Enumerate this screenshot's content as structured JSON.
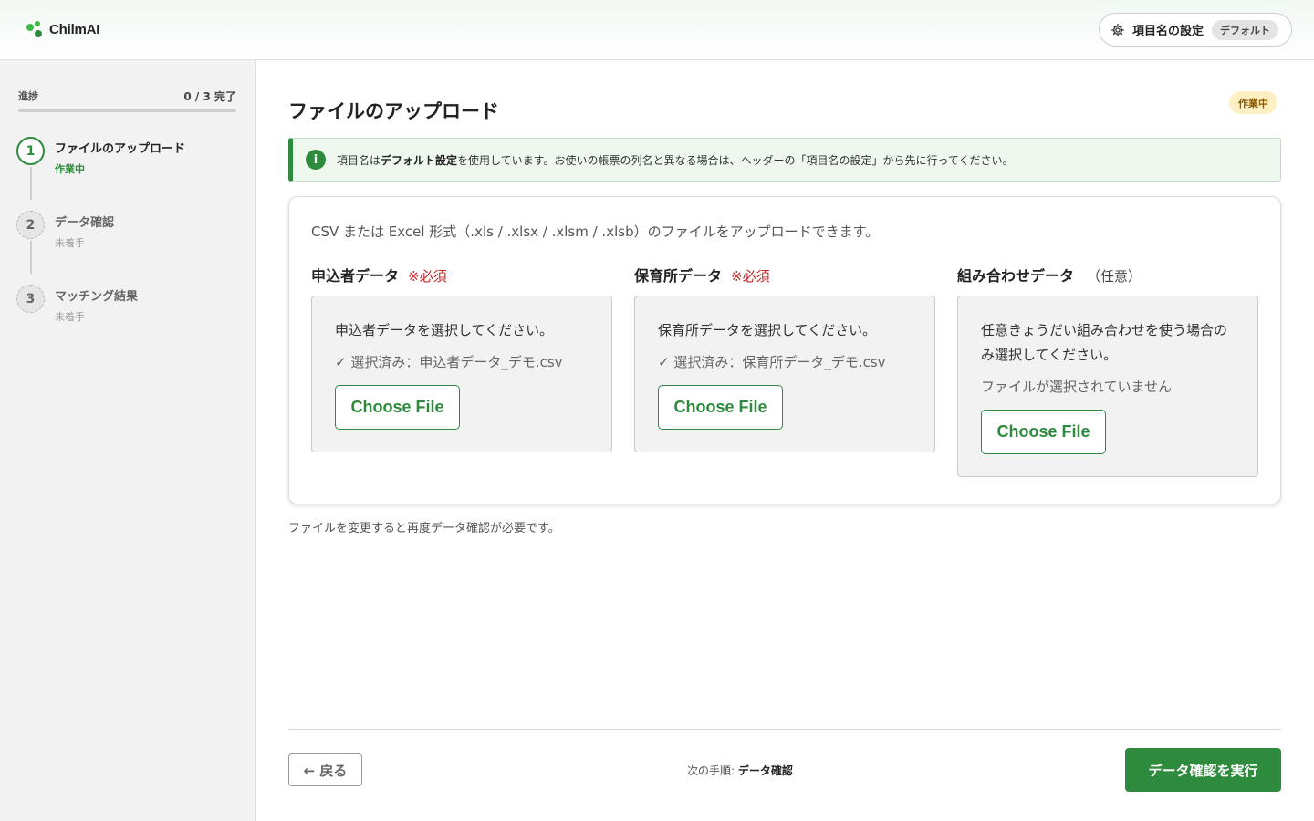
{
  "app": {
    "logo_text": "ChilmAI",
    "brand_color": "#2e8b3d"
  },
  "header": {
    "settings_label": "項目名の設定",
    "settings_badge": "デフォルト",
    "settings_icon": "gear-icon"
  },
  "sidebar": {
    "progress_label": "進捗",
    "progress_count": "0 / 3 完了",
    "progress_fraction": 0,
    "steps": [
      {
        "number": "1",
        "title": "ファイルのアップロード",
        "status": "作業中",
        "state": "active"
      },
      {
        "number": "2",
        "title": "データ確認",
        "status": "未着手",
        "state": "pending"
      },
      {
        "number": "3",
        "title": "マッチング結果",
        "status": "未着手",
        "state": "pending"
      }
    ]
  },
  "main": {
    "title": "ファイルのアップロード",
    "status_badge": "作業中",
    "notice": {
      "icon": "info-icon",
      "icon_glyph": "i",
      "prefix": "項目名は",
      "emphasis": "デフォルト設定",
      "suffix": "を使用しています。お使いの帳票の列名と異なる場合は、ヘッダーの「項目名の設定」から先に行ってください。"
    },
    "upload": {
      "description": "CSV または Excel 形式（.xls / .xlsx / .xlsm / .xlsb）のファイルをアップロードできます。",
      "columns": [
        {
          "title": "申込者データ",
          "tag": "※必須",
          "tag_type": "required",
          "prompt": "申込者データを選択してください。",
          "status": "✓ 選択済み：申込者データ_デモ.csv",
          "button": "Choose File"
        },
        {
          "title": "保育所データ",
          "tag": "※必須",
          "tag_type": "required",
          "prompt": "保育所データを選択してください。",
          "status": "✓ 選択済み：保育所データ_デモ.csv",
          "button": "Choose File"
        },
        {
          "title": "組み合わせデータ",
          "tag": "（任意）",
          "tag_type": "optional",
          "prompt": "任意きょうだい組み合わせを使う場合のみ選択してください。",
          "status": "ファイルが選択されていません",
          "button": "Choose File"
        }
      ]
    },
    "footnote": "ファイルを変更すると再度データ確認が必要です。"
  },
  "footer": {
    "back_label": "← 戻る",
    "next_step_label": "次の手順:",
    "next_step_value": "データ確認",
    "run_label": "データ確認を実行"
  }
}
